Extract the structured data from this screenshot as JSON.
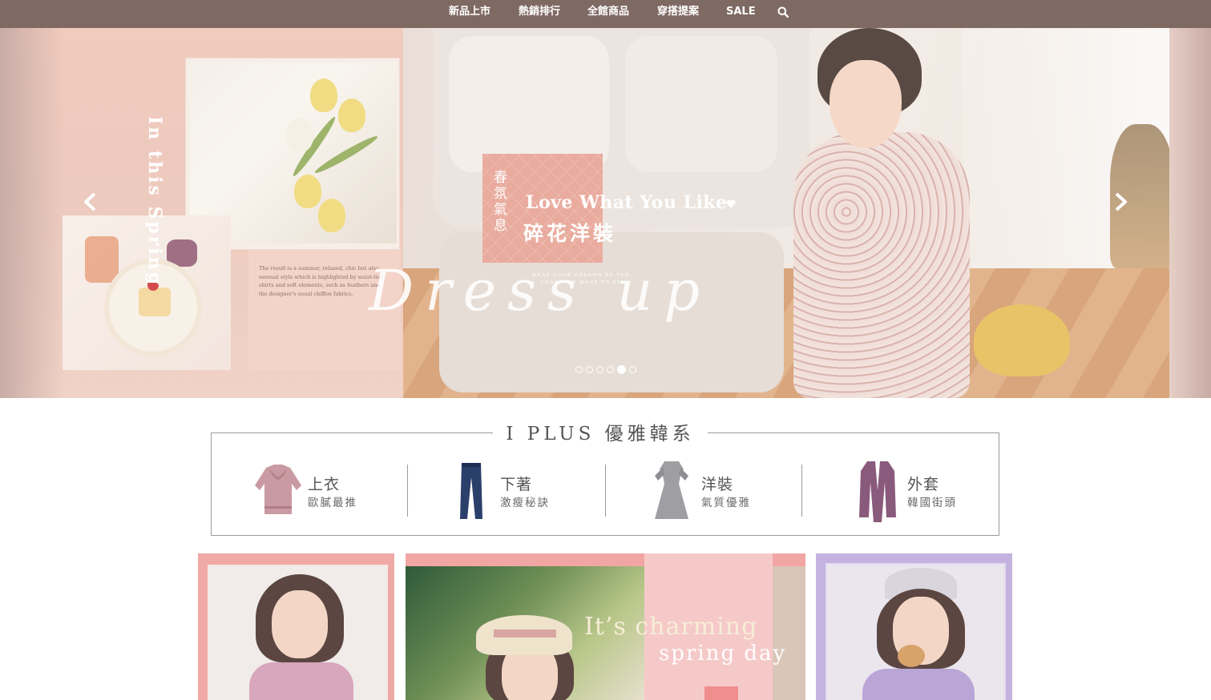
{
  "nav": {
    "items": [
      {
        "label": "新品上市"
      },
      {
        "label": "熱銷排行"
      },
      {
        "label": "全館商品"
      },
      {
        "label": "穿搭提案"
      },
      {
        "label": "SALE"
      }
    ],
    "search_icon": "search-icon",
    "background": "#7f6963"
  },
  "hero": {
    "vertical_title": "In this Spring",
    "label_vertical": "春氛氣息",
    "headline": "Love What You Like",
    "heart_icon": "heart-icon",
    "subheadline": "碎花洋裝",
    "small_caps": "WEAR YOUR DREAMS BE THE CHARM DO WANT TO BE",
    "script": "Dress up",
    "blurb": "The result is a summer, relaxed, chic but also sensual style which is highlighted by waist-tied shirts and soft elements, such as feathers and the designer's usual chiffon fabrics.",
    "prev_icon": "chevron-left-icon",
    "next_icon": "chevron-right-icon",
    "slides": 6,
    "active_slide": 5
  },
  "categories": {
    "title": "I PLUS 優雅韓系",
    "items": [
      {
        "name": "上衣",
        "sub": "歐膩最推",
        "icon": "blouse-icon"
      },
      {
        "name": "下著",
        "sub": "激瘦秘訣",
        "icon": "jeans-icon"
      },
      {
        "name": "洋裝",
        "sub": "氣質優雅",
        "icon": "dress-icon"
      },
      {
        "name": "外套",
        "sub": "韓國街頭",
        "icon": "cardigan-icon"
      }
    ]
  },
  "promos": {
    "center_line1": "It’s charming",
    "center_line2": "spring day"
  },
  "colors": {
    "accent_pink": "#e9ab9e",
    "promo_lilac": "#c4b3e0",
    "promo_pink": "#f2a6a4"
  }
}
